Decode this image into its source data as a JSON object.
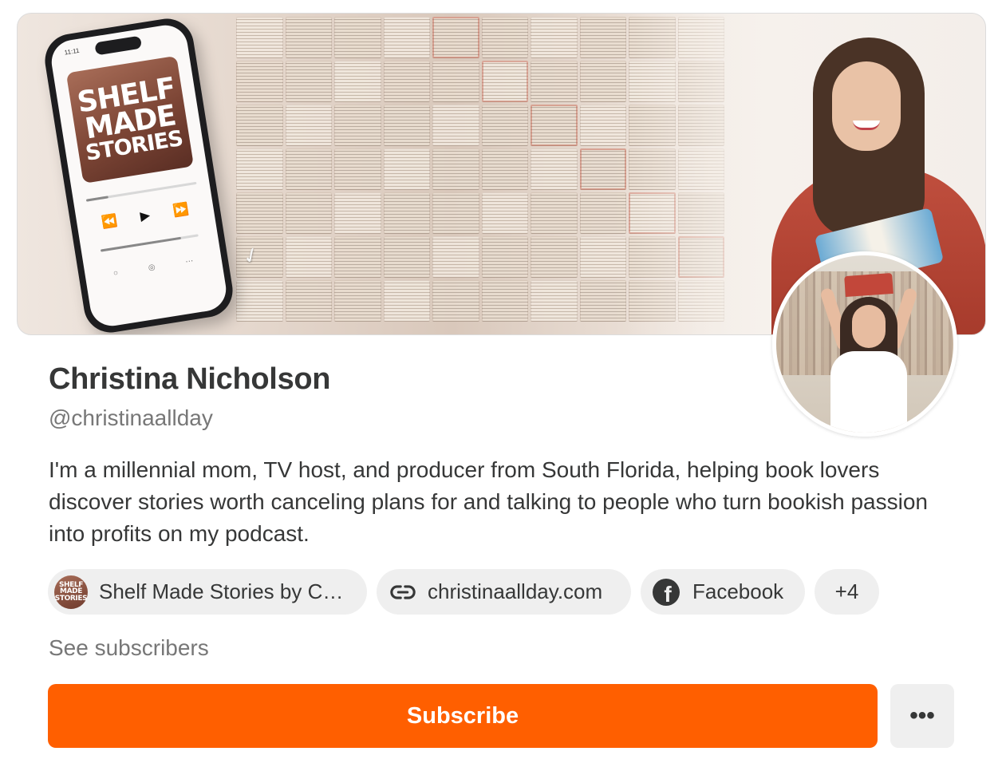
{
  "banner": {
    "phone_time": "11:11",
    "cover_line1": "SHELF",
    "cover_line2": "MADE",
    "cover_line3": "STORIES",
    "playback_progress": 0.2,
    "volume_level": 0.82
  },
  "profile": {
    "name": "Christina Nicholson",
    "handle": "@christinaallday",
    "bio": "I'm a millennial mom, TV host, and producer from South Florida, helping book lovers discover stories worth canceling plans for and talking to people who turn bookish passion into profits on my podcast."
  },
  "chips": {
    "publication": {
      "label": "Shelf Made Stories by C…",
      "icon_line1": "SHELF",
      "icon_line2": "MADE",
      "icon_line3": "STORIES"
    },
    "website": {
      "label": "christinaallday.com",
      "icon": "link-icon"
    },
    "facebook": {
      "label": "Facebook",
      "icon": "facebook-icon",
      "glyph": "f"
    },
    "more": {
      "label": "+4"
    }
  },
  "see_subscribers": "See subscribers",
  "actions": {
    "subscribe_label": "Subscribe",
    "more_label": "•••"
  },
  "colors": {
    "accent": "#ff5f00",
    "chip_bg": "#efefef",
    "text_primary": "#363737",
    "text_secondary": "#777777"
  }
}
